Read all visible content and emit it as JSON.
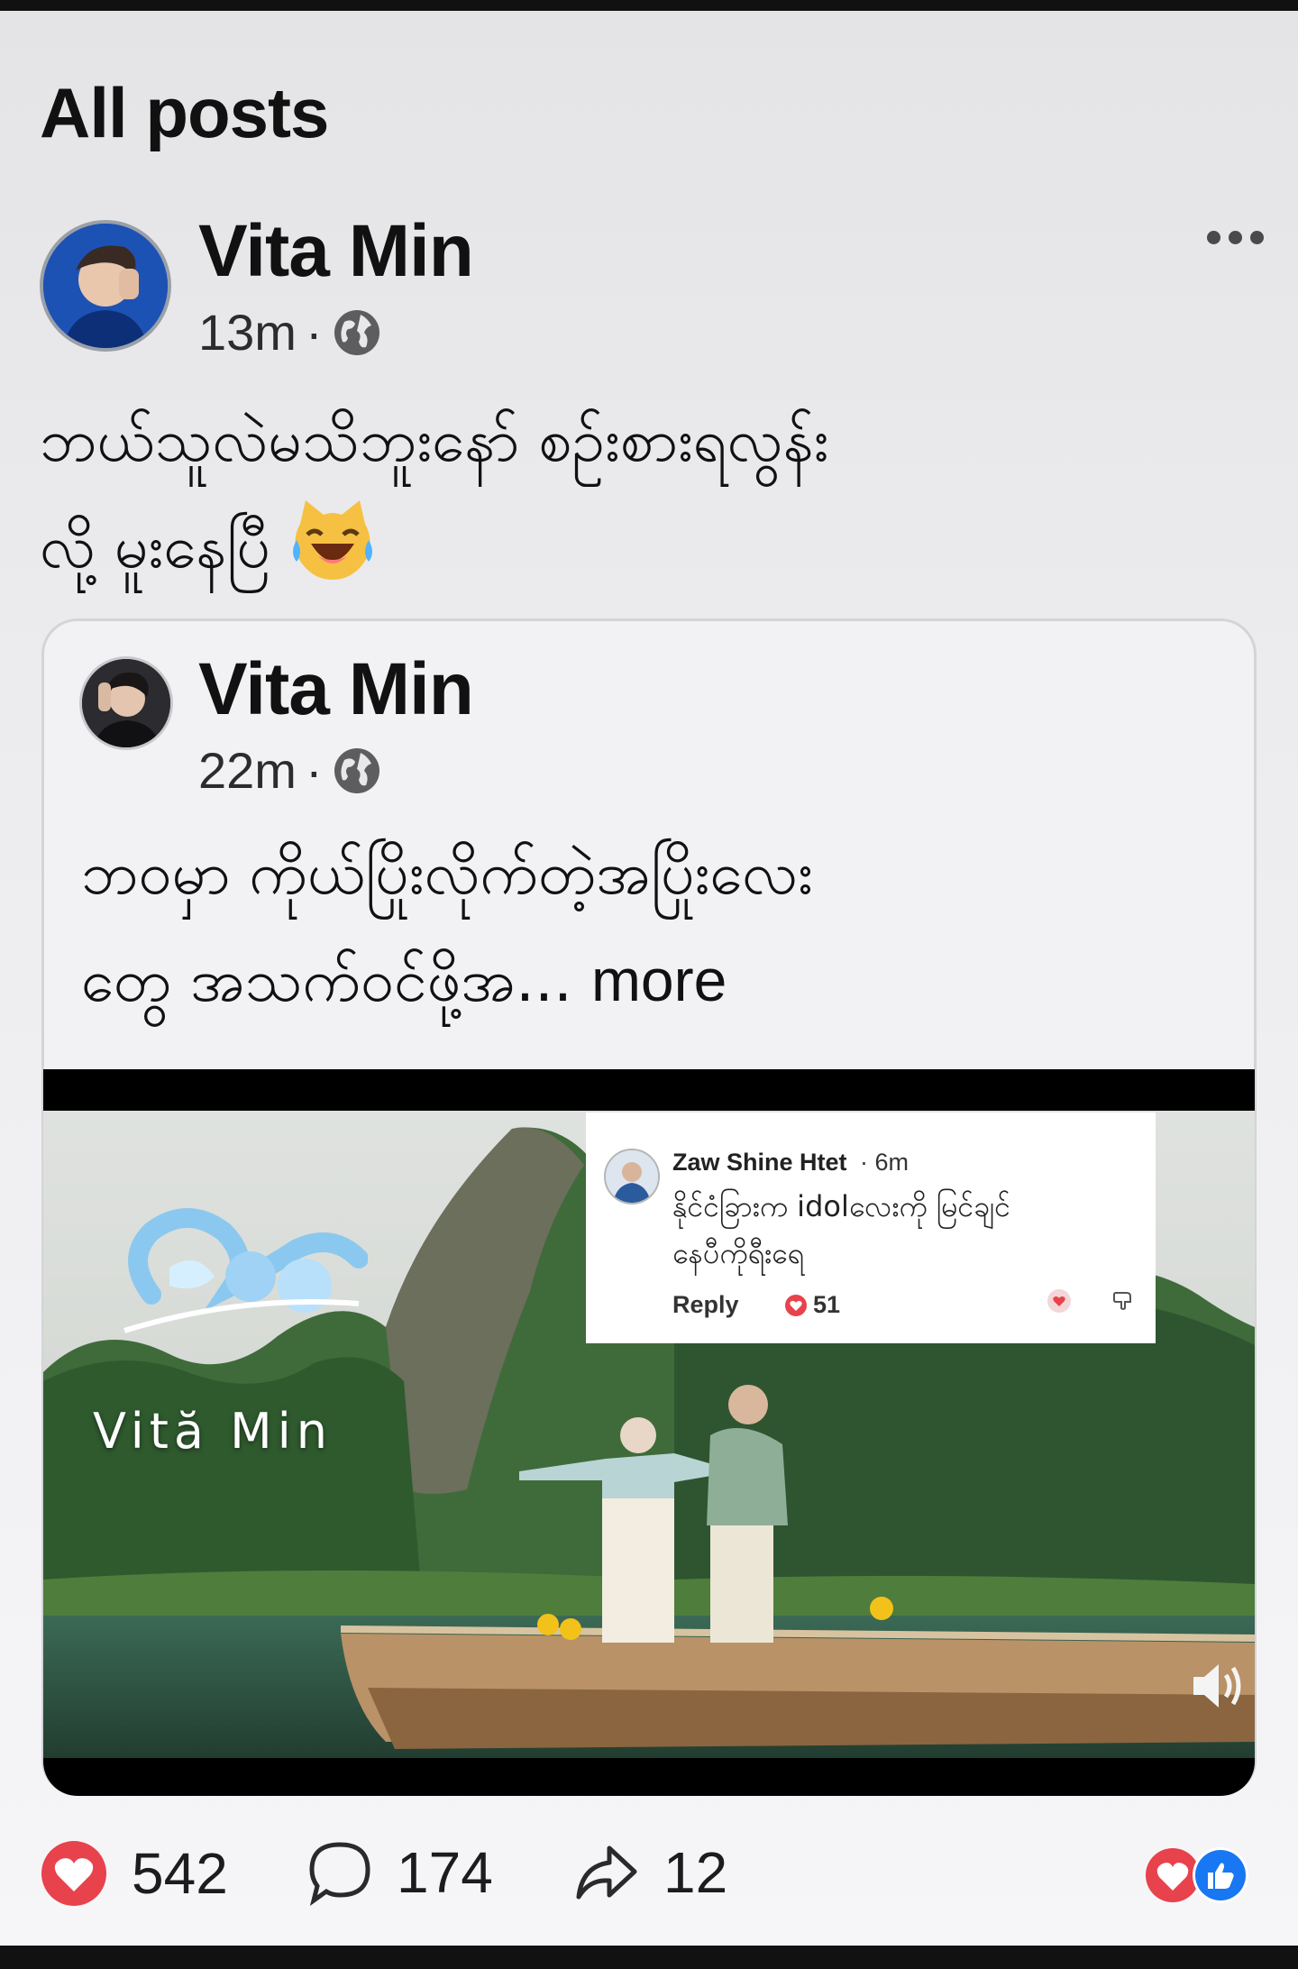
{
  "section": {
    "title": "All posts"
  },
  "post": {
    "author": "Vita Min",
    "time": "13m",
    "separator": "·",
    "text_line1": "ဘယ်သူလဲမသိဘူးနော် စဉ်းစားရလွန်း",
    "text_line2": "လို့ မူးနေပြီ",
    "emoji": "crying-laughing-cat-emoji",
    "shared": {
      "author": "Vita Min",
      "time": "22m",
      "separator": "·",
      "text_line1": "ဘဝမှာ ကိုယ်ပြိုးလိုက်တဲ့အပြိုးလေး",
      "text_line2": "တွေ အသက်ဝင်ဖို့အ...",
      "more_label": "more",
      "video": {
        "logo_text": "Vită Min",
        "comment": {
          "name": "Zaw Shine Htet",
          "time": "· 6m",
          "text_line1": "နိုင်ငံခြားက idolလေးကို မြင်ချင်",
          "text_line2": "နေပီကိုရီးရေ",
          "reply_label": "Reply",
          "likes": "51"
        }
      }
    },
    "stats": {
      "likes": "542",
      "comments": "174",
      "shares": "12"
    }
  },
  "colors": {
    "like_red": "#e8424c",
    "facebook_blue": "#1877f2",
    "background": "#ececee"
  }
}
